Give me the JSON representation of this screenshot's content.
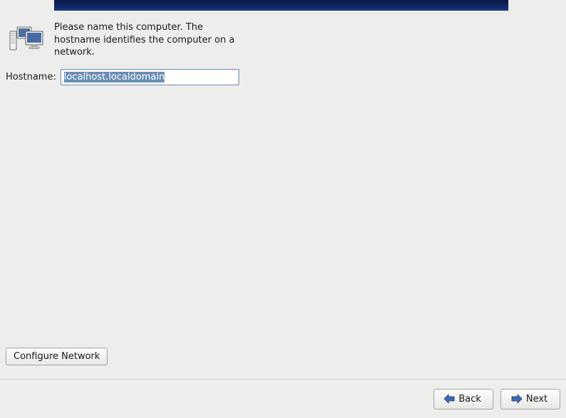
{
  "info": {
    "text": "Please name this computer.  The hostname identifies the computer on a network."
  },
  "hostname": {
    "label": "Hostname:",
    "value": "localhost.localdomain"
  },
  "buttons": {
    "configure_network": "Configure Network",
    "back": "Back",
    "next": "Next"
  }
}
